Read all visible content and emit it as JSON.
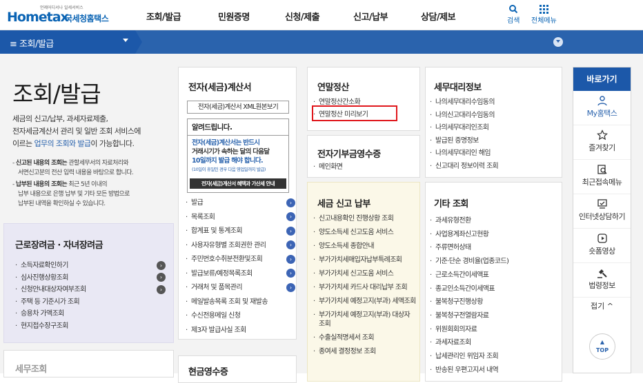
{
  "header": {
    "logo_sub": "언제어디서나 일세서비스",
    "logo_main": "Hometax",
    "logo_kr": "국세청홈택스",
    "nav": [
      "조회/발급",
      "민원증명",
      "신청/제출",
      "신고/납부",
      "상담/제보"
    ],
    "search_label": "검색",
    "all_menu_label": "전체메뉴"
  },
  "bar": {
    "title": "조회/발급"
  },
  "intro": {
    "title": "조회/발급",
    "desc_1": "세금의 신고/납부, 과세자료제출,",
    "desc_2": "전자세금계산서 관리 및 일반 조회 서비스에",
    "desc_3a": "이르는 ",
    "desc_3b": "업무의 조회와 발급",
    "desc_3c": "이 가능합니다.",
    "note_1a": "신고된 내용의 조회는",
    "note_1b": " 관할세무서의 자료처리와",
    "note_1c": "서면신고분의 전산 입력 내용을 바탕으로 합니다.",
    "note_2a": "납부된 내용의 조회는",
    "note_2b": " 최근 5년 이내의",
    "note_2c": "납부 내용으로 은행 납부 및 기타 모든 방법으로",
    "note_2d": "납부된 내역을 확인하실 수 있습니다."
  },
  "e_invoice": {
    "title": "전자(세금)계산서",
    "xml_button": "전자(세금)계산서 XML원본보기",
    "notice_title": "알려드립니다.",
    "notice_1": "전자(세금)계산서는 반드시",
    "notice_2": "거래시기가 속하는 달의 다음달",
    "notice_3": "10일까지 발급 해야 합니다.",
    "notice_4": "(10일이 휴일인 경우 다음 영업일까지 발급)",
    "notice_banner": "전자(세금)계산서 혜택과 가산세 안내",
    "items": [
      "발급",
      "목록조회",
      "합계표 및 통계조회",
      "사용자유형별 조회권한 관리",
      "주민번호수취분전환및조회",
      "발급보류/예정목록조회",
      "거래처 및 품목관리",
      "메일발송목록 조회 및 재발송",
      "수신전용메일 신청",
      "제3자 발급사실 조회"
    ]
  },
  "year_end": {
    "title": "연말정산",
    "items": [
      "연말정산간소화",
      "연말정산 미리보기"
    ]
  },
  "donation": {
    "title": "전자기부금영수증",
    "items": [
      "메인화면"
    ]
  },
  "tax_agent": {
    "title": "세무대리정보",
    "items": [
      "나의세무대리수임동의",
      "나의신고대리수임동의",
      "나의세무대리인조회",
      "발급된 증명정보",
      "나의세무대리인 해임",
      "신고대리 정보이력 조회"
    ]
  },
  "tax_report": {
    "title": "세금 신고 납부",
    "items": [
      "신고내용확인 진행상황 조회",
      "양도소득세 신고도움 서비스",
      "양도소득세 종합안내",
      "부가가치세매입자납부특례조회",
      "부가가치세 신고도움 서비스",
      "부가가치세 카드사 대리납부 조회",
      "부가가치세 예정고지(부과) 세액조회",
      "부가가치세 예정고지(부과) 대상자 조회",
      "수출실적명세서 조회",
      "종여세 결정정보 조회"
    ]
  },
  "other": {
    "title": "기타 조회",
    "items": [
      "과세유형전환",
      "사업용계좌신고현황",
      "주류면허상태",
      "기준·단순 경비율(업종코드)",
      "근로소득간이세액표",
      "종교인소득간이세액표",
      "불복청구진행상황",
      "불복청구전열람자료",
      "위원회회의자료",
      "과세자료조회",
      "납세관리인 위임자 조회",
      "반송된 우편고지서 내역"
    ]
  },
  "earned_income": {
    "title": "근로장려금 · 자녀장려금",
    "items": [
      "소득자료확인하기",
      "심사진행상황조회",
      "신청안내대상자여부조회",
      "주택 등 기준시가 조회",
      "승용차 가액조회",
      "현지접수장구조회"
    ]
  },
  "bottom": {
    "left_title": "세무조회",
    "mid_title": "현금영수증"
  },
  "quick": {
    "title": "바로가기",
    "items": [
      "My홈택스",
      "즐겨찾기",
      "최근접속메뉴",
      "인터넷상담하기",
      "숏폼영상",
      "법령정보"
    ],
    "fold": "접기",
    "top": "TOP"
  },
  "colors": {
    "brand_blue": "#1c58a9",
    "highlight_red": "#e0161b"
  }
}
